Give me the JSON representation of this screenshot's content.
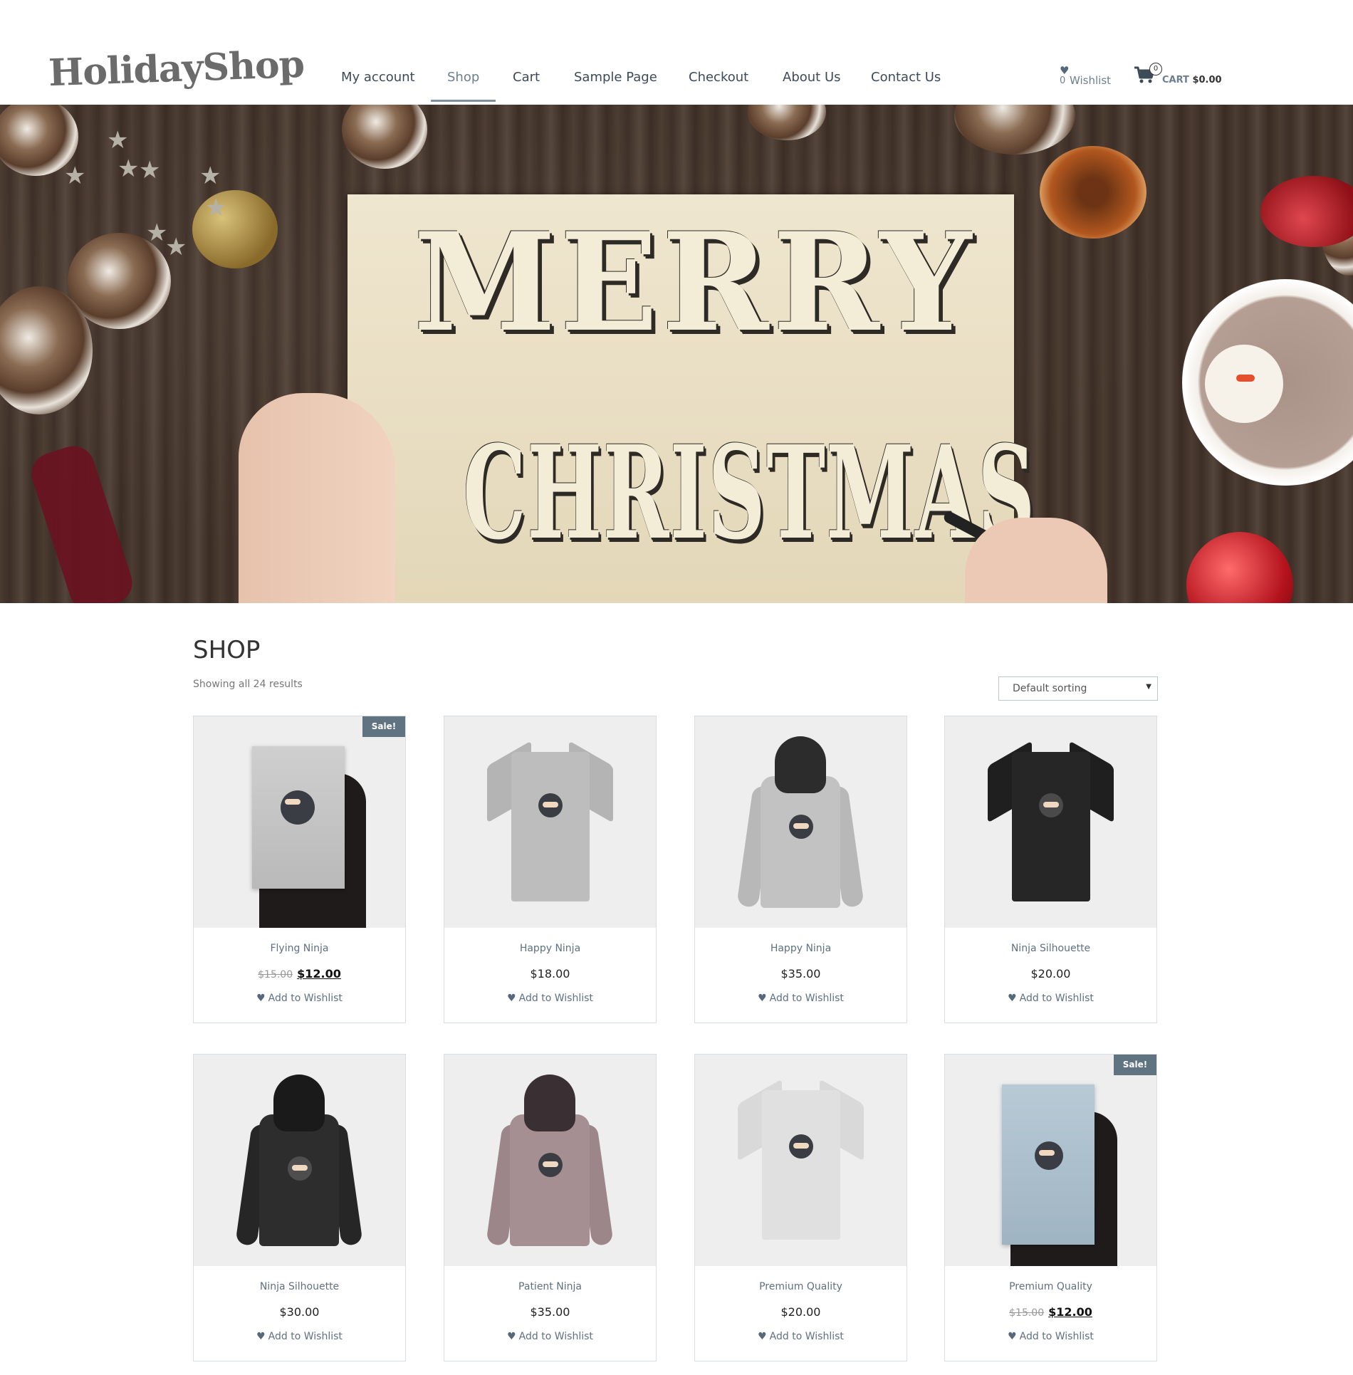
{
  "header": {
    "logo_text": "HolidayShop",
    "nav": [
      {
        "label": "My account"
      },
      {
        "label": "Shop",
        "active": true
      },
      {
        "label": "Cart"
      },
      {
        "label": "Sample Page"
      },
      {
        "label": "Checkout"
      },
      {
        "label": "About Us"
      },
      {
        "label": "Contact Us"
      }
    ],
    "wishlist": {
      "count": "0",
      "label": "Wishlist"
    },
    "cart": {
      "count": "0",
      "label": "CART",
      "total": "$0.00"
    }
  },
  "hero": {
    "line1": "MERRY",
    "line2": "CHRISTMAS"
  },
  "shop": {
    "title": "SHOP",
    "result_count": "Showing all 24 results",
    "sorting": {
      "selected": "Default sorting"
    },
    "wishlist_action_label": "Add to Wishlist",
    "sale_label": "Sale!",
    "products": [
      {
        "name": "Flying Ninja",
        "old_price": "$15.00",
        "price": "$12.00",
        "on_sale": true,
        "image": "poster"
      },
      {
        "name": "Happy Ninja",
        "price": "$18.00",
        "on_sale": false,
        "image": "tee-grey"
      },
      {
        "name": "Happy Ninja",
        "price": "$35.00",
        "on_sale": false,
        "image": "hoodie-grey"
      },
      {
        "name": "Ninja Silhouette",
        "price": "$20.00",
        "on_sale": false,
        "image": "tee-black"
      },
      {
        "name": "Ninja Silhouette",
        "price": "$30.00",
        "on_sale": false,
        "image": "hoodie-black"
      },
      {
        "name": "Patient Ninja",
        "price": "$35.00",
        "on_sale": false,
        "image": "hoodie-mauve"
      },
      {
        "name": "Premium Quality",
        "price": "$20.00",
        "on_sale": false,
        "image": "tee-white"
      },
      {
        "name": "Premium Quality",
        "old_price": "$15.00",
        "price": "$12.00",
        "on_sale": true,
        "image": "poster-blue"
      }
    ]
  },
  "colors": {
    "accent": "#5f7381",
    "nav_text": "#3d4a57",
    "link": "#607080",
    "border": "#d7dde2"
  }
}
